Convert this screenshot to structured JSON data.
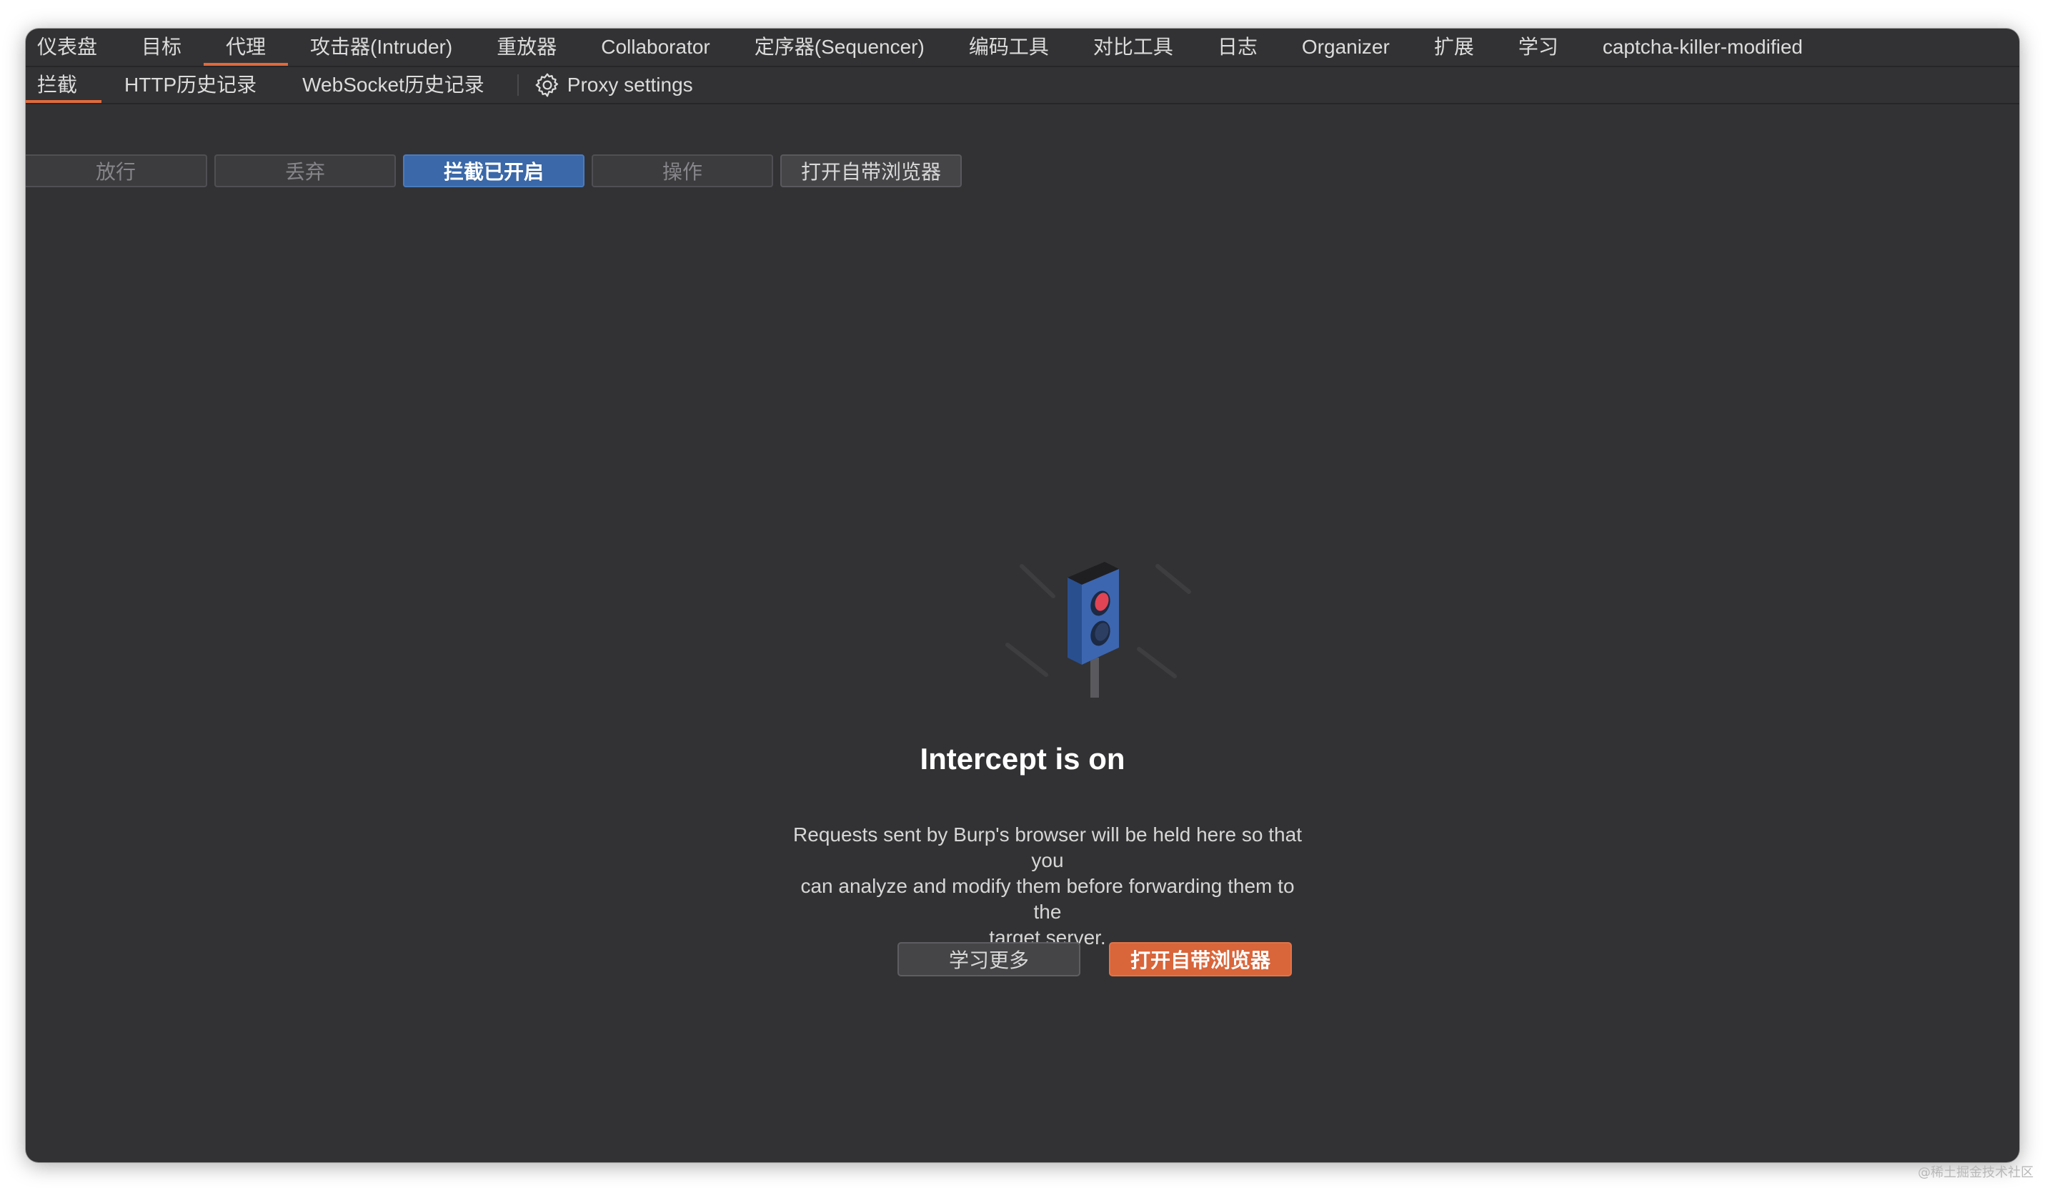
{
  "main_tabs": [
    {
      "label": "仪表盘"
    },
    {
      "label": "目标"
    },
    {
      "label": "代理",
      "active": true
    },
    {
      "label": "攻击器(Intruder)"
    },
    {
      "label": "重放器"
    },
    {
      "label": "Collaborator"
    },
    {
      "label": "定序器(Sequencer)"
    },
    {
      "label": "编码工具"
    },
    {
      "label": "对比工具"
    },
    {
      "label": "日志"
    },
    {
      "label": "Organizer"
    },
    {
      "label": "扩展"
    },
    {
      "label": "学习"
    },
    {
      "label": "captcha-killer-modified"
    }
  ],
  "sub_tabs": [
    {
      "label": "拦截",
      "active": true
    },
    {
      "label": "HTTP历史记录"
    },
    {
      "label": "WebSocket历史记录"
    }
  ],
  "proxy_settings": {
    "label": "Proxy settings",
    "icon": "gear-icon"
  },
  "toolbar": {
    "forward": "放行",
    "drop": "丢弃",
    "intercept_toggle": "拦截已开启",
    "action": "操作",
    "open_browser": "打开自带浏览器"
  },
  "empty_state": {
    "icon": "traffic-light-icon",
    "title": "Intercept is on",
    "description_lines": [
      "Requests sent by Burp's browser will be held here so that you",
      "can analyze and modify them before forwarding them to the",
      "target server."
    ],
    "learn_more": "学习更多",
    "open_browser": "打开自带浏览器"
  },
  "watermark": "@稀土掘金技术社区",
  "colors": {
    "background": "#323234",
    "accent": "#e06a3d",
    "primary": "#3a68a8",
    "cta": "#d9653a"
  }
}
